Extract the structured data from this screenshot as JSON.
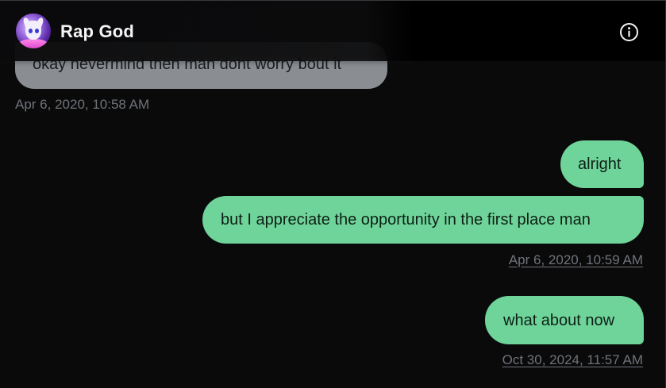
{
  "conversation": {
    "name": "Rap God"
  },
  "messages": [
    {
      "direction": "received",
      "text": "okay nevermind then man dont worry bout it"
    },
    {
      "direction": "sent",
      "text": "alright"
    },
    {
      "direction": "sent",
      "text": "but I appreciate the opportunity in the first place man"
    },
    {
      "direction": "sent",
      "text": "what about now"
    }
  ],
  "timestamps": [
    "Apr 6, 2020, 10:58 AM",
    "Apr 6, 2020, 10:59 AM",
    "Oct 30, 2024, 11:57 AM"
  ],
  "icons": {
    "info": "info-icon",
    "avatar": "avatar-image"
  },
  "colors": {
    "background": "#0a0a0b",
    "sent_bubble": "#6fd49a",
    "received_bubble": "#8a8e93",
    "timestamp": "#6f7378",
    "title": "#f4f4f5"
  }
}
